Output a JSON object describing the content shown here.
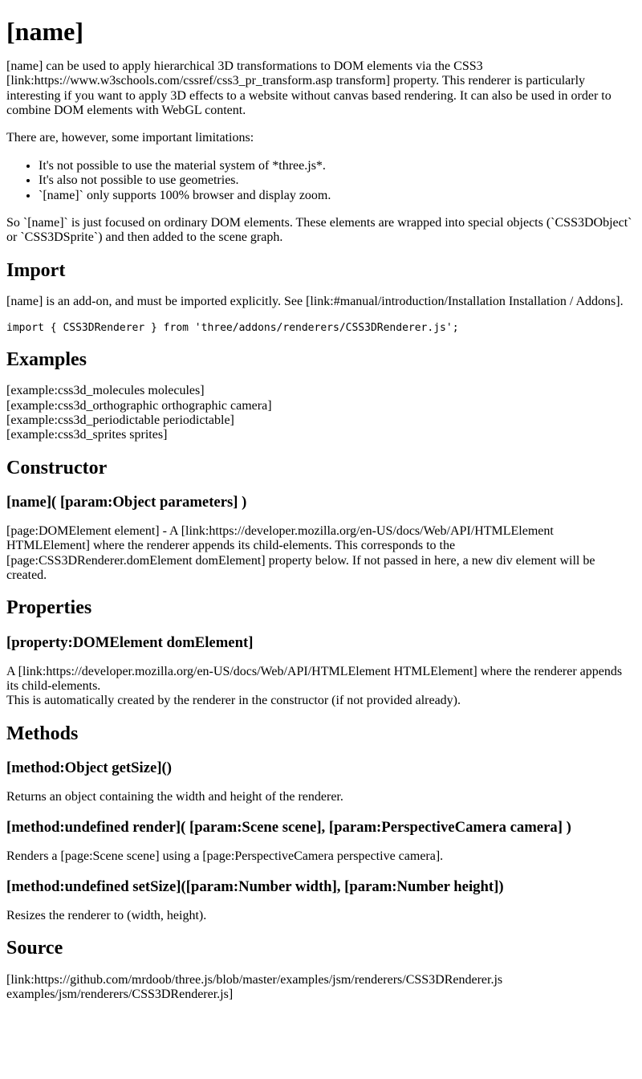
{
  "title": "[name]",
  "intro": {
    "p1": "[name] can be used to apply hierarchical 3D transformations to DOM elements via the CSS3 [link:https://www.w3schools.com/cssref/css3_pr_transform.asp transform] property. This renderer is particularly interesting if you want to apply 3D effects to a website without canvas based rendering. It can also be used in order to combine DOM elements with WebGL content.",
    "p2": "There are, however, some important limitations:",
    "limitations": [
      "It's not possible to use the material system of *three.js*.",
      "It's also not possible to use geometries.",
      "`[name]` only supports 100% browser and display zoom."
    ],
    "p3": "So `[name]` is just focused on ordinary DOM elements. These elements are wrapped into special objects (`CSS3DObject` or `CSS3DSprite`) and then added to the scene graph."
  },
  "import": {
    "heading": "Import",
    "text": "[name] is an add-on, and must be imported explicitly. See [link:#manual/introduction/Installation Installation / Addons].",
    "code": "import { CSS3DRenderer } from 'three/addons/renderers/CSS3DRenderer.js';"
  },
  "examples": {
    "heading": "Examples",
    "items": [
      "[example:css3d_molecules molecules]",
      "[example:css3d_orthographic orthographic camera]",
      "[example:css3d_periodictable periodictable]",
      "[example:css3d_sprites sprites]"
    ]
  },
  "constructor": {
    "heading": "Constructor",
    "signature": "[name]( [param:Object parameters] )",
    "text": "[page:DOMElement element] - A [link:https://developer.mozilla.org/en-US/docs/Web/API/HTMLElement HTMLElement] where the renderer appends its child-elements. This corresponds to the [page:CSS3DRenderer.domElement domElement] property below. If not passed in here, a new div element will be created."
  },
  "properties": {
    "heading": "Properties",
    "signature": "[property:DOMElement domElement]",
    "line1": "A [link:https://developer.mozilla.org/en-US/docs/Web/API/HTMLElement HTMLElement] where the renderer appends its child-elements.",
    "line2": "This is automatically created by the renderer in the constructor (if not provided already)."
  },
  "methods": {
    "heading": "Methods",
    "items": [
      {
        "signature": "[method:Object getSize]()",
        "text": "Returns an object containing the width and height of the renderer."
      },
      {
        "signature": "[method:undefined render]( [param:Scene scene], [param:PerspectiveCamera camera] )",
        "text": "Renders a [page:Scene scene] using a [page:PerspectiveCamera perspective camera]."
      },
      {
        "signature": "[method:undefined setSize]([param:Number width], [param:Number height])",
        "text": "Resizes the renderer to (width, height)."
      }
    ]
  },
  "source": {
    "heading": "Source",
    "text": "[link:https://github.com/mrdoob/three.js/blob/master/examples/jsm/renderers/CSS3DRenderer.js examples/jsm/renderers/CSS3DRenderer.js]"
  }
}
